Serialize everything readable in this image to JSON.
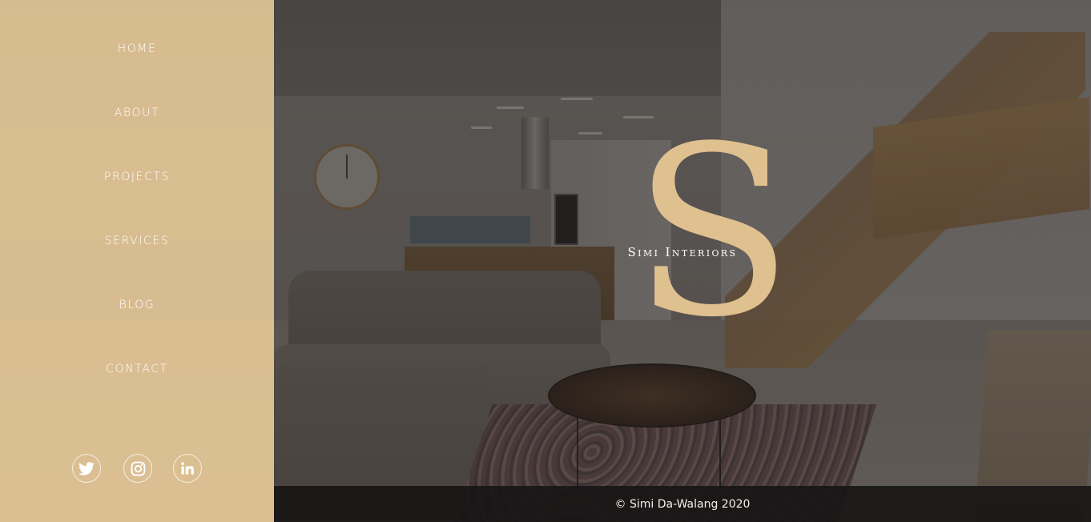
{
  "nav": {
    "items": [
      {
        "label": "HOME"
      },
      {
        "label": "ABOUT"
      },
      {
        "label": "PROJECTS"
      },
      {
        "label": "SERVICES"
      },
      {
        "label": "BLOG"
      },
      {
        "label": "CONTACT"
      }
    ]
  },
  "social": [
    {
      "icon": "twitter-icon"
    },
    {
      "icon": "instagram-icon"
    },
    {
      "icon": "linkedin-icon"
    }
  ],
  "logo": {
    "letter": "S",
    "name": "Simi Interiors"
  },
  "footer": {
    "copyright": "© Simi Da-Walang 2020"
  },
  "colors": {
    "sidebar": "#dec192",
    "logo_gold": "#dfc08f",
    "footer_bg": "#141313"
  }
}
